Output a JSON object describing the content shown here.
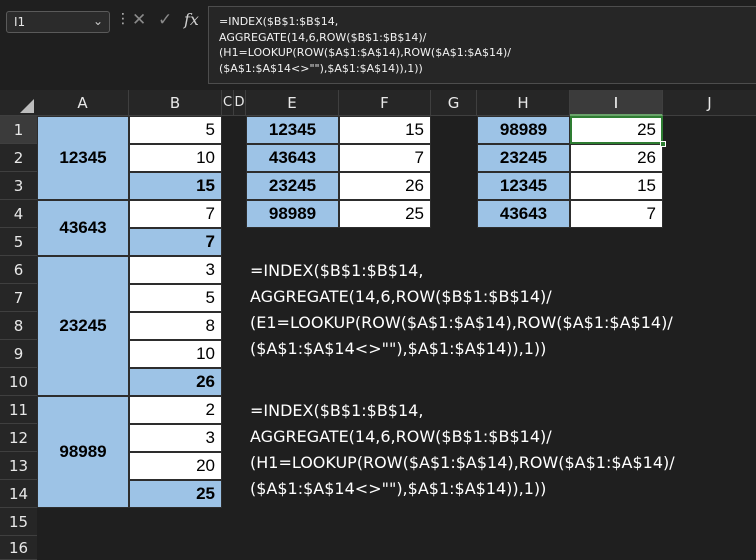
{
  "name_box": {
    "value": "I1"
  },
  "formula_bar": {
    "lines": [
      "=INDEX($B$1:$B$14,",
      "AGGREGATE(14,6,ROW($B$1:$B$14)/",
      "(H1=LOOKUP(ROW($A$1:$A$14),ROW($A$1:$A$14)/",
      "($A$1:$A$14<>\"\"),$A$1:$A$14)),1))"
    ]
  },
  "columns": [
    "A",
    "B",
    "C",
    "D",
    "E",
    "F",
    "G",
    "H",
    "I",
    "J"
  ],
  "rows": [
    "1",
    "2",
    "3",
    "4",
    "5",
    "6",
    "7",
    "8",
    "9",
    "10",
    "11",
    "12",
    "13",
    "14",
    "15",
    "16"
  ],
  "col_a_merged": [
    "12345",
    "43643",
    "23245",
    "98989"
  ],
  "col_b": [
    "5",
    "10",
    "15",
    "7",
    "7",
    "3",
    "5",
    "8",
    "10",
    "26",
    "2",
    "3",
    "20",
    "25"
  ],
  "table_ef": [
    [
      "12345",
      "15"
    ],
    [
      "43643",
      "7"
    ],
    [
      "23245",
      "26"
    ],
    [
      "98989",
      "25"
    ]
  ],
  "table_hi": [
    [
      "98989",
      "25"
    ],
    [
      "23245",
      "26"
    ],
    [
      "12345",
      "15"
    ],
    [
      "43643",
      "7"
    ]
  ],
  "formula_text_1": [
    "=INDEX($B$1:$B$14,",
    "AGGREGATE(14,6,ROW($B$1:$B$14)/",
    "(E1=LOOKUP(ROW($A$1:$A$14),ROW($A$1:$A$14)/",
    "($A$1:$A$14<>\"\"),$A$1:$A$14)),1))"
  ],
  "formula_text_2": [
    "=INDEX($B$1:$B$14,",
    "AGGREGATE(14,6,ROW($B$1:$B$14)/",
    "(H1=LOOKUP(ROW($A$1:$A$14),ROW($A$1:$A$14)/",
    "($A$1:$A$14<>\"\"),$A$1:$A$14)),1))"
  ],
  "colors": {
    "cell_blue": "#9dc3e6",
    "active_border": "#2e7d32"
  }
}
